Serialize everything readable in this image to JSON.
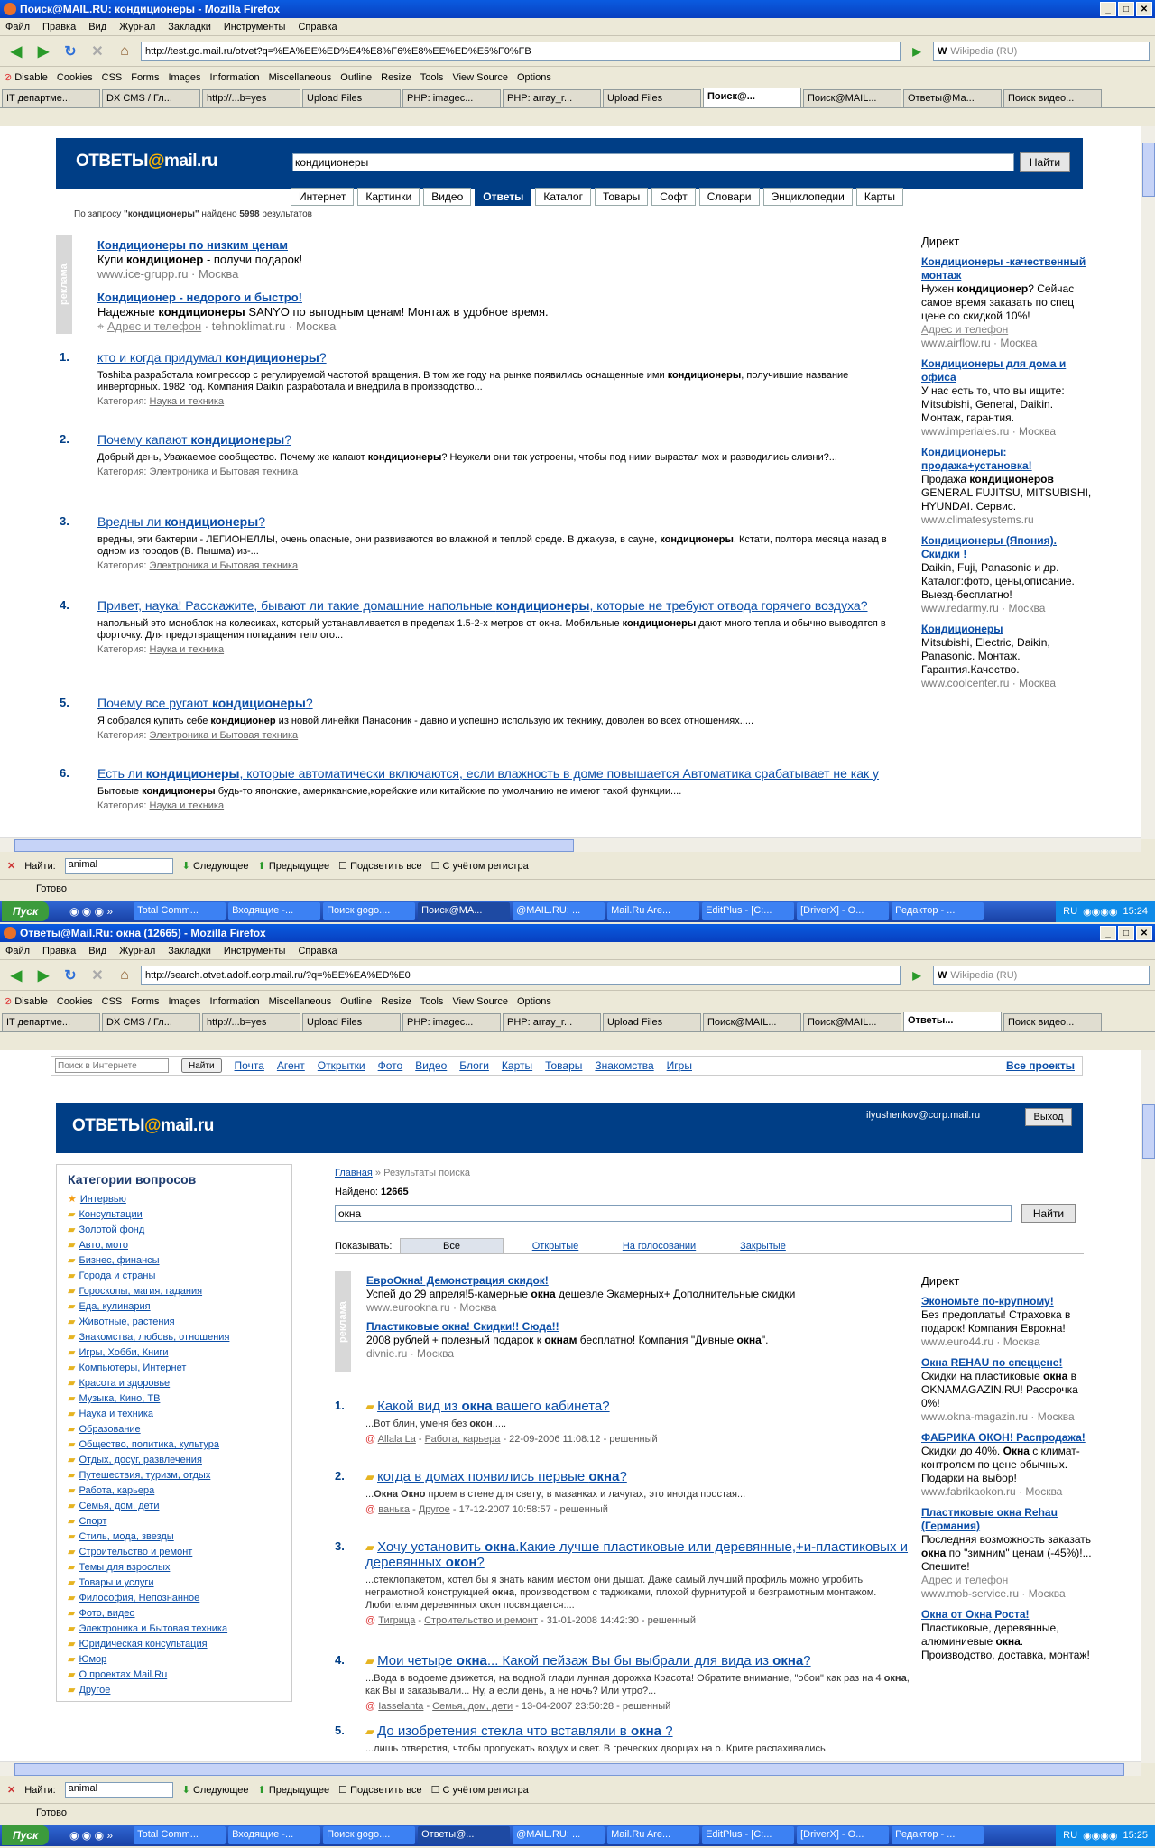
{
  "w1": {
    "title": "Поиск@MAIL.RU: кондиционеры - Mozilla Firefox",
    "menu": [
      "Файл",
      "Правка",
      "Вид",
      "Журнал",
      "Закладки",
      "Инструменты",
      "Справка"
    ],
    "url": "http://test.go.mail.ru/otvet?q=%EA%EE%ED%E4%E8%F6%E8%EE%ED%E5%F0%FB",
    "search_placeholder": "Wikipedia (RU)",
    "devbar": [
      "Disable",
      "Cookies",
      "CSS",
      "Forms",
      "Images",
      "Information",
      "Miscellaneous",
      "Outline",
      "Resize",
      "Tools",
      "View Source",
      "Options"
    ],
    "tabs": [
      "IT департме...",
      "DX CMS / Гл...",
      "http://...b=yes",
      "Upload Files",
      "PHP: imagec...",
      "PHP: array_r...",
      "Upload Files",
      "Поиск@...",
      "Поиск@MAIL...",
      "Ответы@Ма...",
      "Поиск видео..."
    ],
    "page": {
      "logo_a": "ОТВЕТЫ",
      "logo_b": "@",
      "logo_c": "mail.ru",
      "query": "кондиционеры",
      "find_btn": "Найти",
      "tabs": [
        "Интернет",
        "Картинки",
        "Видео",
        "Ответы",
        "Каталог",
        "Товары",
        "Софт",
        "Словари",
        "Энциклопедии",
        "Карты"
      ],
      "stats_a": "По запросу ",
      "stats_q": "\"кондиционеры\"",
      "stats_b": " найдено ",
      "stats_n": "5998",
      "stats_c": " результатов",
      "ad_label": "реклама",
      "ads": [
        {
          "title": "Кондиционеры по низким ценам",
          "t1": "Купи ",
          "b1": "кондиционер",
          "t2": " - получи подарок!",
          "url": "www.ice-grupp.ru",
          "city": "Москва"
        },
        {
          "title": "Кондиционер - недорого и быстро!",
          "t1": "Надежные ",
          "b1": "кондиционеры",
          "t2": " SANYO по выгодным ценам! Монтаж в удобное время.",
          "addr": "Адрес и телефон",
          "url": "tehnoklimat.ru",
          "city": "Москва"
        }
      ],
      "results": [
        {
          "n": "1.",
          "q1": "кто и когда придумал ",
          "qb": "кондиционеры",
          "q2": "?",
          "s1": "Toshiba разработала компрессор с регулируемой частотой вращения. В том же году на рынке появились оснащенные ими ",
          "sb": "кондиционеры",
          "s2": ", получившие название инверторных. 1982 год. Компания Daikin разработала и внедрила в производство...",
          "cat_l": "Категория: ",
          "cat": "Наука и техника"
        },
        {
          "n": "2.",
          "q1": "Почему капают ",
          "qb": "кондиционеры",
          "q2": "?",
          "s1": "Добрый день, Уважаемое сообщество. Почему же капают ",
          "sb": "кондиционеры",
          "s2": "? Неужели они так устроены, чтобы под ними вырастал мох и разводились слизни?...",
          "cat_l": "Категория: ",
          "cat": "Электроника и Бытовая техника"
        },
        {
          "n": "3.",
          "q1": "Вредны ли ",
          "qb": "кондиционеры",
          "q2": "?",
          "s1": "вредны, эти бактерии - ЛЕГИОНЕЛЛЫ, очень опасные, они развиваются во влажной и теплой среде. В джакуза, в сауне, ",
          "sb": "кондиционеры",
          "s2": ". Кстати, полтора месяца назад в одном из городов (В. Пышма) из-...",
          "cat_l": "Категория: ",
          "cat": "Электроника и Бытовая техника"
        },
        {
          "n": "4.",
          "q1": "Привет, наука! Расскажите, бывают ли такие домашние напольные ",
          "qb": "кондиционеры",
          "q2": ", которые не требуют отвода горячего воздуха?",
          "s1": "напольный это моноблок на колесиках, который устанавливается в пределах 1.5-2-х метров от окна. Мобильные ",
          "sb": "кондиционеры",
          "s2": " дают много тепла и обычно выводятся в форточку. Для предотвращения попадания теплого...",
          "cat_l": "Категория: ",
          "cat": "Наука и техника"
        },
        {
          "n": "5.",
          "q1": "Почему все ругают ",
          "qb": "кондиционеры",
          "q2": "?",
          "s1": "Я собрался купить себе ",
          "sb": "кондиционер",
          "s2": " из новой линейки Панасоник - давно и успешно использую их технику, доволен во всех отношениях.....",
          "cat_l": "Категория: ",
          "cat": "Электроника и Бытовая техника"
        },
        {
          "n": "6.",
          "q1": "Есть ли ",
          "qb": "кондиционеры",
          "q2": ", которые автоматически включаются, если влажность в доме повышается Автоматика срабатывает не как у",
          "s1": "Бытовые ",
          "sb": "кондиционеры",
          "s2": " будь-то японские, американские,корейские или китайские по умолчанию не имеют такой функции....",
          "cat_l": "Категория: ",
          "cat": "Наука и техника"
        }
      ],
      "direct_title": "Директ",
      "direct": [
        {
          "title": "Кондиционеры -качественный монтаж",
          "t1": "Нужен ",
          "b1": "кондиционер",
          "t2": "? Сейчас самое время заказать по спец цене со скидкой 10%!",
          "addr": "Адрес и телефон",
          "url": "www.airflow.ru",
          "city": "Москва"
        },
        {
          "title": "Кондиционеры для дома и офиса",
          "t1": "У нас есть то, что вы ищите: Mitsubishi, General, Daikin. Монтаж, гарантия.",
          "b1": "",
          "t2": "",
          "addr": "",
          "url": "www.imperiales.ru",
          "city": "Москва"
        },
        {
          "title": "Кондиционеры: продажа+установка!",
          "t1": "Продажа ",
          "b1": "кондиционеров",
          "t2": " GENERAL FUJITSU, MITSUBISHI, HYUNDAI. Сервис.",
          "addr": "",
          "url": "www.climatesystems.ru",
          "city": ""
        },
        {
          "title": "Кондиционеры (Япония). Скидки !",
          "t1": "Daikin, Fuji, Panasonic и др. Каталог:фото, цены,описание. Выезд-бесплатно!",
          "b1": "",
          "t2": "",
          "addr": "",
          "url": "www.redarmy.ru",
          "city": "Москва"
        },
        {
          "title": "Кондиционеры",
          "t1": "Mitsubishi, Electric, Daikin, Panasonic. Монтаж. Гарантия.Качество.",
          "b1": "",
          "t2": "",
          "addr": "",
          "url": "www.coolcenter.ru",
          "city": "Москва"
        }
      ]
    },
    "find": {
      "label": "Найти:",
      "value": "animal",
      "next": "Следующее",
      "prev": "Предыдущее",
      "highlight": "Подсветить все",
      "case": "С учётом регистра"
    },
    "status": "Готово",
    "taskbar": {
      "start": "Пуск",
      "items": [
        "Total Comm...",
        "Входящие -...",
        "Поиск gogo....",
        "Поиск@MA...",
        "@MAIL.RU: ...",
        "Mail.Ru Are...",
        "EditPlus - [C:...",
        "[DriverX] - O...",
        "Редактор - ..."
      ],
      "lang": "RU",
      "time": "15:24"
    }
  },
  "w2": {
    "title": "Ответы@Mail.Ru: окна (12665) - Mozilla Firefox",
    "menu": [
      "Файл",
      "Правка",
      "Вид",
      "Журнал",
      "Закладки",
      "Инструменты",
      "Справка"
    ],
    "url": "http://search.otvet.adolf.corp.mail.ru/?q=%EE%EA%ED%E0",
    "search_placeholder": "Wikipedia (RU)",
    "devbar": [
      "Disable",
      "Cookies",
      "CSS",
      "Forms",
      "Images",
      "Information",
      "Miscellaneous",
      "Outline",
      "Resize",
      "Tools",
      "View Source",
      "Options"
    ],
    "tabs": [
      "IT департме...",
      "DX CMS / Гл...",
      "http://...b=yes",
      "Upload Files",
      "PHP: imagec...",
      "PHP: array_r...",
      "Upload Files",
      "Поиск@MAIL...",
      "Поиск@MAIL...",
      "Ответы...",
      "Поиск видео..."
    ],
    "page": {
      "portal_placeholder": "Поиск в Интернете",
      "portal_btn": "Найти",
      "portal": [
        "Почта",
        "Агент",
        "Открытки",
        "Фото",
        "Видео",
        "Блоги",
        "Карты",
        "Товары",
        "Знакомства",
        "Игры"
      ],
      "portal_all": "Все проекты",
      "logo_a": "ОТВЕТЫ",
      "logo_b": "@",
      "logo_c": "mail.ru",
      "user": "ilyushenkov@corp.mail.ru",
      "logout": "Выход",
      "cat_title": "Категории вопросов",
      "categories": [
        "Интервью",
        "Консультации",
        "Золотой фонд",
        "Авто, мото",
        "Бизнес, финансы",
        "Города и страны",
        "Гороскопы, магия, гадания",
        "Еда, кулинария",
        "Животные, растения",
        "Знакомства, любовь, отношения",
        "Игры, Хобби, Книги",
        "Компьютеры, Интернет",
        "Красота и здоровье",
        "Музыка, Кино, ТВ",
        "Наука и техника",
        "Образование",
        "Общество, политика, культура",
        "Отдых, досуг, развлечения",
        "Путешествия, туризм, отдых",
        "Работа, карьера",
        "Семья, дом, дети",
        "Спорт",
        "Стиль, мода, звезды",
        "Строительство и ремонт",
        "Темы для взрослых",
        "Товары и услуги",
        "Философия, Непознанное",
        "Фото, видео",
        "Электроника и Бытовая техника",
        "Юридическая консультация",
        "Юмор",
        "О проектах Mail.Ru",
        "Другое"
      ],
      "bc_home": "Главная",
      "bc_sep": " » ",
      "bc_cur": "Результаты поиска",
      "found_l": "Найдено: ",
      "found_n": "12665",
      "query": "окна",
      "find_btn": "Найти",
      "show_l": "Показывать:",
      "filters": [
        "Все",
        "Открытые",
        "На голосовании",
        "Закрытые"
      ],
      "ad_label": "реклама",
      "ads": [
        {
          "title": "ЕвроОкна! Демонстрация скидок!",
          "t1": "Успей до 29 апреля!5-камерные ",
          "b1": "окна",
          "t2": " дешевле Экамерных+ Дополнительные скидки",
          "url": "www.eurookna.ru",
          "city": "Москва"
        },
        {
          "title": "Пластиковые окна! Скидки!! Сюда!!",
          "t1": "2008 рублей + полезный подарок к ",
          "b1": "окнам",
          "t2": " бесплатно! Компания \"Дивные ",
          "b2": "окна",
          "t3": "\".",
          "url": "divnie.ru",
          "city": "Москва"
        }
      ],
      "results": [
        {
          "n": "1.",
          "q1": "Какой вид из ",
          "qb": "окна",
          "q2": " вашего кабинета?",
          "q3": "",
          "q4": "",
          "s": "...Вот блин, уменя без ",
          "sb": "окон",
          "s2": ".....",
          "user": "Allala La",
          "cat": "Работа, карьера",
          "date": " - 22-09-2006 11:08:12 - решенный"
        },
        {
          "n": "2.",
          "q1": "когда в домах появились первые ",
          "qb": "окна",
          "q2": "?",
          "q3": "",
          "q4": "",
          "s": "...",
          "sb": "Окна Окно",
          "s2": " проем в стене для свету; в мазанках и лачугах, это иногда простая...",
          "user": "ванька",
          "cat": "Другое",
          "date": " - 17-12-2007 10:58:57 - решенный"
        },
        {
          "n": "3.",
          "q1": "Хочу установить ",
          "qb": "окна",
          "q2": ".Какие лучше пластиковые или деревянные,+и-пластиковых и деревянных ",
          "q3": "окон",
          "q4": "?",
          "s": "...стеклопакетом, хотел бы я знать каким местом они дышат. Даже самый лучший профиль можно угробить неграмотной конструкцией ",
          "sb": "окна",
          "s2": ", производством с таджиками, плохой фурнитурой и безграмотным монтажом. Любителям деревянных окон посвящается:...",
          "user": "Тигрица",
          "cat": "Строительство и ремонт",
          "date": " - 31-01-2008 14:42:30 - решенный"
        },
        {
          "n": "4.",
          "q1": "Мои четыре ",
          "qb": "окна",
          "q2": "... Какой пейзаж Вы бы выбрали для вида из ",
          "q3": "окна",
          "q4": "?",
          "s": "...Вода в водоеме движется, на водной глади лунная дорожка Красота! Обратите внимание, \"обои\" как раз на 4 ",
          "sb": "окна",
          "s2": ", как Вы и заказывали... Ну, а если день, а не ночь? Или утро?...",
          "user": "Iasselanta",
          "cat": "Семья, дом, дети",
          "date": " - 13-04-2007 23:50:28 - решенный"
        },
        {
          "n": "5.",
          "q1": "До изобретения стекла что вставляли в ",
          "qb": "окна",
          "q2": " ?",
          "q3": "",
          "q4": "",
          "s": "...лишь отверстия, чтобы пропускать воздух и свет. В греческих дворцах на о. Крите распахивались",
          "sb": "",
          "s2": "",
          "user": "",
          "cat": "",
          "date": ""
        }
      ],
      "direct_title": "Директ",
      "direct": [
        {
          "title": "Экономьте по-крупному!",
          "t1": "Без предоплаты! Страховка в подарок! Компания Еврокна!",
          "b1": "",
          "t2": "",
          "addr": "",
          "url": "www.euro44.ru",
          "city": "Москва"
        },
        {
          "title": "Окна REHAU по спеццене!",
          "t1": "Скидки на пластиковые ",
          "b1": "окна",
          "t2": " в OKNAMAGAZIN.RU! Рассрочка 0%!",
          "addr": "",
          "url": "www.okna-magazin.ru",
          "city": "Москва"
        },
        {
          "title": "ФАБРИКА ОКОН! Распродажа!",
          "t1": "Скидки до 40%. ",
          "b1": "Окна",
          "t2": " с климат-контролем по цене обычных. Подарки на выбор!",
          "addr": "",
          "url": "www.fabrikaokon.ru",
          "city": "Москва"
        },
        {
          "title": "Пластиковые окна Rehau (Германия)",
          "t1": "Последняя возможность заказать ",
          "b1": "окна",
          "t2": " по \"зимним\" ценам (-45%)!... Спешите!",
          "addr": "Адрес и телефон",
          "url": "www.mob-service.ru",
          "city": "Москва"
        },
        {
          "title": "Окна от Окна Роста!",
          "t1": "Пластиковые, деревянные, алюминиевые ",
          "b1": "окна",
          "t2": ". Производство, доставка, монтаж!",
          "addr": "",
          "url": "",
          "city": ""
        }
      ]
    },
    "find": {
      "label": "Найти:",
      "value": "animal",
      "next": "Следующее",
      "prev": "Предыдущее",
      "highlight": "Подсветить все",
      "case": "С учётом регистра"
    },
    "status": "Готово",
    "taskbar": {
      "start": "Пуск",
      "items": [
        "Total Comm...",
        "Входящие -...",
        "Поиск gogo....",
        "Ответы@...",
        "@MAIL.RU: ...",
        "Mail.Ru Are...",
        "EditPlus - [C:...",
        "[DriverX] - O...",
        "Редактор - ..."
      ],
      "lang": "RU",
      "time": "15:25"
    }
  },
  "colors": {
    "brand": "#003e86",
    "accent": "#ffb400",
    "link": "#0b4ea8"
  }
}
